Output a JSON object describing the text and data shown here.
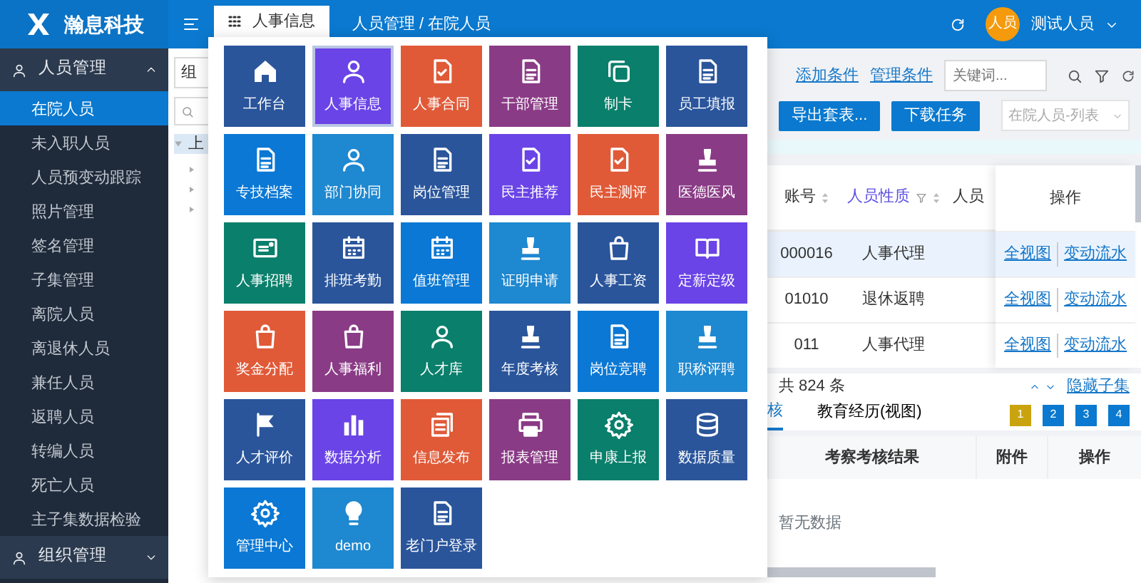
{
  "header": {
    "logo": "瀚息科技",
    "tab": {
      "label": "人事信息"
    },
    "breadcrumb": "人员管理 / 在院人员",
    "avatar": "人员",
    "user": "测试人员"
  },
  "sidebar": {
    "groups": [
      {
        "label": "人员管理",
        "expanded": true,
        "items": [
          {
            "label": "在院人员",
            "selected": true
          },
          {
            "label": "未入职人员",
            "selected": false
          },
          {
            "label": "人员预变动跟踪",
            "selected": false
          },
          {
            "label": "照片管理",
            "selected": false
          },
          {
            "label": "签名管理",
            "selected": false
          },
          {
            "label": "子集管理",
            "selected": false
          },
          {
            "label": "离院人员",
            "selected": false
          },
          {
            "label": "离退休人员",
            "selected": false
          },
          {
            "label": "兼任人员",
            "selected": false
          },
          {
            "label": "返聘人员",
            "selected": false
          },
          {
            "label": "转编人员",
            "selected": false
          },
          {
            "label": "死亡人员",
            "selected": false
          },
          {
            "label": "主子集数据检验",
            "selected": false
          }
        ]
      },
      {
        "label": "组织管理",
        "expanded": false
      }
    ]
  },
  "tree_panel": {
    "select": "组",
    "tree_root": "上"
  },
  "toolbar": {
    "links": [
      "添加条件",
      "管理条件"
    ],
    "search": {
      "placeholder": "关键词..."
    }
  },
  "actions": {
    "buttons": [
      "导出套表...",
      "下载任务"
    ],
    "view_select": "在院人员-列表"
  },
  "table": {
    "columns": [
      {
        "label": "账号",
        "sortable": true,
        "filterable": false
      },
      {
        "label": "人员性质",
        "sortable": true,
        "filterable": true
      },
      {
        "label": "人员",
        "sortable": false,
        "filterable": false
      },
      {
        "label": "操作",
        "sortable": false,
        "filterable": false
      }
    ],
    "rows": [
      {
        "cells": [
          "000016",
          "人事代理"
        ],
        "selected": true,
        "actions": [
          "全视图",
          "变动流水"
        ]
      },
      {
        "cells": [
          "01010",
          "退休返聘"
        ],
        "selected": false,
        "actions": [
          "全视图",
          "变动流水"
        ]
      },
      {
        "cells": [
          "011",
          "人事代理"
        ],
        "selected": false,
        "actions": [
          "全视图",
          "变动流水"
        ]
      }
    ]
  },
  "footer": {
    "total": "共 824 条",
    "toggle": "隐藏子集"
  },
  "subset": {
    "tabs": [
      {
        "label": "核",
        "selected": true
      },
      {
        "label": "教育经历(视图)",
        "selected": false
      }
    ],
    "pages": [
      {
        "label": "1",
        "selected": true
      },
      {
        "label": "2",
        "selected": false
      },
      {
        "label": "3",
        "selected": false
      },
      {
        "label": "4",
        "selected": false
      }
    ],
    "columns": [
      "考察考核结果",
      "附件",
      "操作"
    ],
    "empty": "暂无数据"
  },
  "app_menu": {
    "tiles": [
      {
        "label": "工作台",
        "color": "#2a559b",
        "selected": false
      },
      {
        "label": "人事信息",
        "color": "#6a44e6",
        "selected": true
      },
      {
        "label": "人事合同",
        "color": "#e05a38",
        "selected": false
      },
      {
        "label": "干部管理",
        "color": "#8a3b86",
        "selected": false
      },
      {
        "label": "制卡",
        "color": "#0a7f6b",
        "selected": false
      },
      {
        "label": "员工填报",
        "color": "#2a559b",
        "selected": false
      },
      {
        "label": "专技档案",
        "color": "#0a78d4",
        "selected": false
      },
      {
        "label": "部门协同",
        "color": "#1e88d0",
        "selected": false
      },
      {
        "label": "岗位管理",
        "color": "#2a559b",
        "selected": false
      },
      {
        "label": "民主推荐",
        "color": "#6a44e6",
        "selected": false
      },
      {
        "label": "民主测评",
        "color": "#e05a38",
        "selected": false
      },
      {
        "label": "医德医风",
        "color": "#8a3b86",
        "selected": false
      },
      {
        "label": "人事招聘",
        "color": "#0a7f6b",
        "selected": false
      },
      {
        "label": "排班考勤",
        "color": "#2a559b",
        "selected": false
      },
      {
        "label": "值班管理",
        "color": "#0a78d4",
        "selected": false
      },
      {
        "label": "证明申请",
        "color": "#1e88d0",
        "selected": false
      },
      {
        "label": "人事工资",
        "color": "#2a559b",
        "selected": false
      },
      {
        "label": "定薪定级",
        "color": "#6a44e6",
        "selected": false
      },
      {
        "label": "奖金分配",
        "color": "#e05a38",
        "selected": false
      },
      {
        "label": "人事福利",
        "color": "#8a3b86",
        "selected": false
      },
      {
        "label": "人才库",
        "color": "#0a7f6b",
        "selected": false
      },
      {
        "label": "年度考核",
        "color": "#2a559b",
        "selected": false
      },
      {
        "label": "岗位竞聘",
        "color": "#0a78d4",
        "selected": false
      },
      {
        "label": "职称评聘",
        "color": "#1e88d0",
        "selected": false
      },
      {
        "label": "人才评价",
        "color": "#2a559b",
        "selected": false
      },
      {
        "label": "数据分析",
        "color": "#6a44e6",
        "selected": false
      },
      {
        "label": "信息发布",
        "color": "#e05a38",
        "selected": false
      },
      {
        "label": "报表管理",
        "color": "#8a3b86",
        "selected": false
      },
      {
        "label": "申康上报",
        "color": "#0a7f6b",
        "selected": false
      },
      {
        "label": "数据质量",
        "color": "#2a559b",
        "selected": false
      },
      {
        "label": "管理中心",
        "color": "#0a78d4",
        "selected": false
      },
      {
        "label": "demo",
        "color": "#1e88d0",
        "selected": false
      },
      {
        "label": "老门户登录",
        "color": "#2a559b",
        "selected": false
      }
    ]
  }
}
